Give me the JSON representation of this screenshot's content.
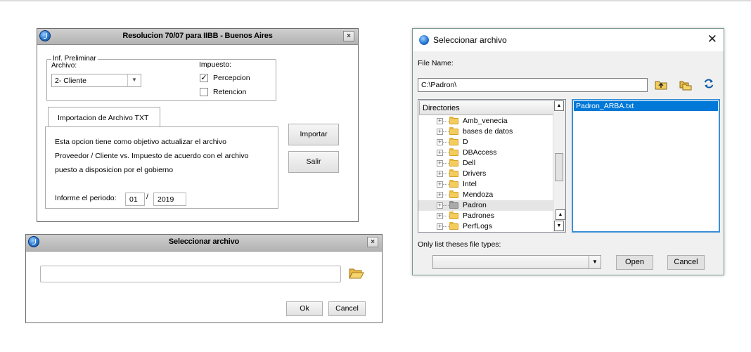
{
  "dialog1": {
    "title": "Resolucion 70/07 para IIBB - Buenos Aires",
    "close": "×",
    "preliminar_label": "Inf. Preliminar",
    "archivo_label": "Archivo:",
    "archivo_value": "2- Cliente",
    "impuesto_label": "Impuesto:",
    "percepcion_label": "Percepcion",
    "percepcion_checked": true,
    "retencion_label": "Retencion",
    "retencion_checked": false,
    "tab_label": "Importacion de Archivo TXT",
    "desc_line1": "Esta opcion tiene como objetivo actualizar el archivo",
    "desc_line2": "Proveedor / Cliente  vs. Impuesto de acuerdo con el archivo",
    "desc_line3": "puesto a disposicion por el gobierno",
    "periodo_label": "Informe el periodo:",
    "periodo_month": "01",
    "periodo_sep": "/",
    "periodo_year": "2019",
    "importar_label": "Importar",
    "salir_label": "Salir"
  },
  "dialog2": {
    "title": "Seleccionar archivo",
    "close": "×",
    "path_value": "",
    "ok_label": "Ok",
    "cancel_label": "Cancel"
  },
  "filedialog": {
    "title": "Seleccionar archivo",
    "close": "✕",
    "filename_label": "File Name:",
    "filename_value": "C:\\Padron\\",
    "directories_header": "Directories",
    "directories": [
      {
        "name": "Amb_venecia",
        "selected": false
      },
      {
        "name": "bases de datos",
        "selected": false
      },
      {
        "name": "D",
        "selected": false
      },
      {
        "name": "DBAccess",
        "selected": false
      },
      {
        "name": "Dell",
        "selected": false
      },
      {
        "name": "Drivers",
        "selected": false
      },
      {
        "name": "Intel",
        "selected": false
      },
      {
        "name": "Mendoza",
        "selected": false
      },
      {
        "name": "Padron",
        "selected": true
      },
      {
        "name": "Padrones",
        "selected": false
      },
      {
        "name": "PerfLogs",
        "selected": false
      }
    ],
    "files": [
      "Padron_ARBA.txt"
    ],
    "filetypes_label": "Only list theses file types:",
    "filetype_value": "",
    "open_label": "Open",
    "cancel_label": "Cancel"
  },
  "icons": {
    "app": "app-logo-icon",
    "folder_up": "folder-up-icon",
    "new_folder": "new-folder-icon",
    "refresh": "refresh-icon",
    "open_folder": "open-folder-icon"
  }
}
